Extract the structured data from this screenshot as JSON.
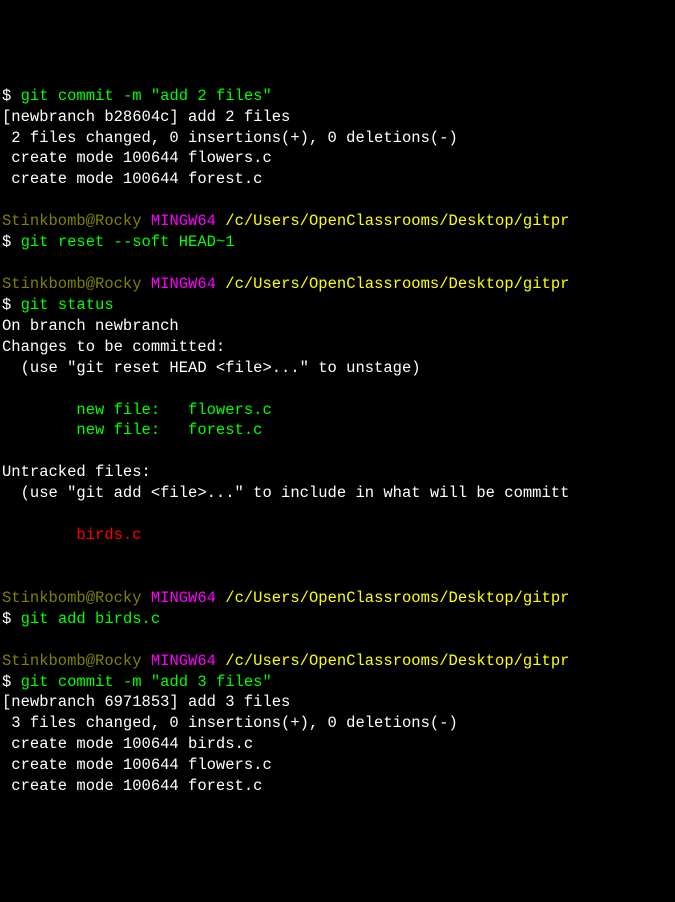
{
  "prompt_user": "Stinkbomb@Rocky",
  "prompt_msys": "MINGW64",
  "prompt_path": "/c/Users/OpenClassrooms/Desktop/gitpr",
  "prompt_dollar": "$",
  "blocks": {
    "b0_cmd": "git commit -m \"add 2 files\"",
    "b0_line1": "[newbranch b28604c] add 2 files",
    "b0_line2": " 2 files changed, 0 insertions(+), 0 deletions(-)",
    "b0_line3": " create mode 100644 flowers.c",
    "b0_line4": " create mode 100644 forest.c",
    "b1_cmd": "git reset --soft HEAD~1",
    "b2_cmd": "git status",
    "b2_line1": "On branch newbranch",
    "b2_line2": "Changes to be committed:",
    "b2_line3": "  (use \"git reset HEAD <file>...\" to unstage)",
    "b2_newfile_prefix": "        new file:   ",
    "b2_file1": "flowers.c",
    "b2_file2": "forest.c",
    "b2_line6": "Untracked files:",
    "b2_line7": "  (use \"git add <file>...\" to include in what will be committ",
    "b2_untracked_indent": "        ",
    "b2_untracked1": "birds.c",
    "b3_cmd": "git add birds.c",
    "b4_cmd": "git commit -m \"add 3 files\"",
    "b4_line1": "[newbranch 6971853] add 3 files",
    "b4_line2": " 3 files changed, 0 insertions(+), 0 deletions(-)",
    "b4_line3": " create mode 100644 birds.c",
    "b4_line4": " create mode 100644 flowers.c",
    "b4_line5": " create mode 100644 forest.c"
  }
}
